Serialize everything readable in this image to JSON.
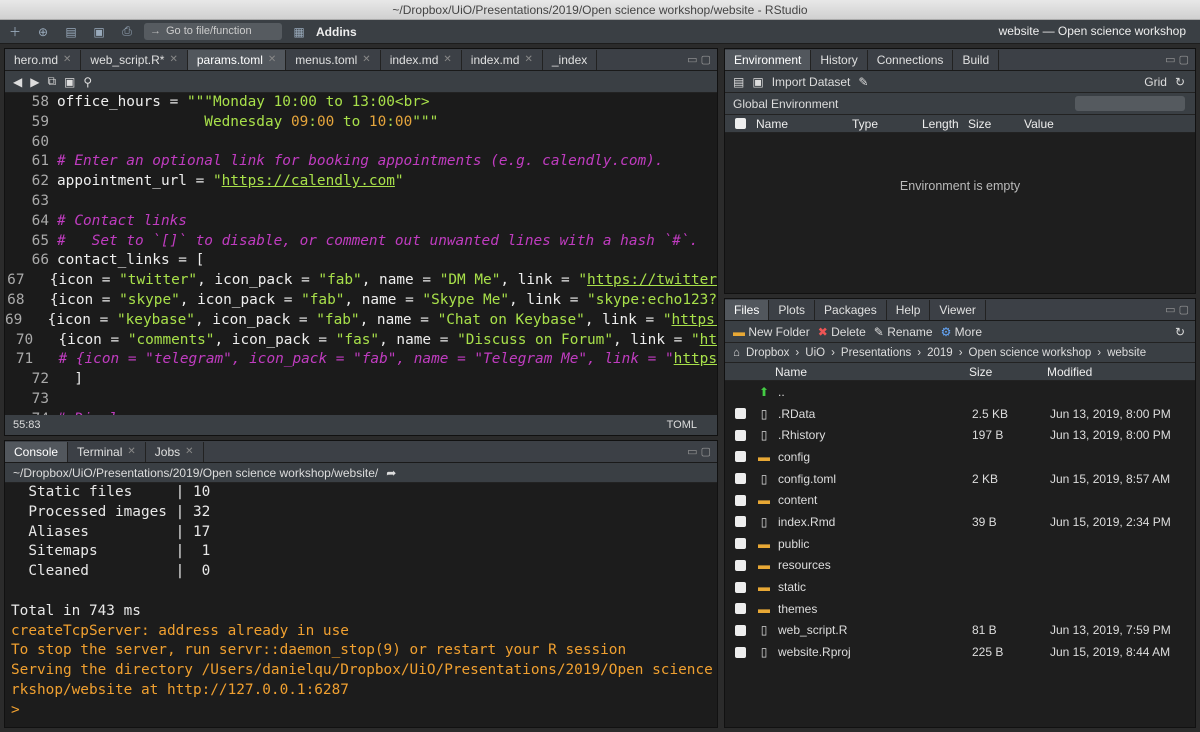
{
  "window_title": "~/Dropbox/UiO/Presentations/2019/Open science workshop/website - RStudio",
  "toolbar": {
    "goto_placeholder": "Go to file/function",
    "addins_label": "Addins",
    "project_label": "website — Open science workshop"
  },
  "editor": {
    "tabs": [
      {
        "label": "hero.md"
      },
      {
        "label": "web_script.R*"
      },
      {
        "label": "params.toml"
      },
      {
        "label": "menus.toml"
      },
      {
        "label": "index.md"
      },
      {
        "label": "index.md"
      },
      {
        "label": "_index"
      }
    ],
    "position": "55:83",
    "filetype": "TOML",
    "lines": [
      {
        "n": "58",
        "parts": [
          {
            "t": "office_hours = ",
            "c": "src"
          },
          {
            "t": "\"\"\"Monday 10:00 to 13:00<br>",
            "c": "c-str"
          }
        ]
      },
      {
        "n": "59",
        "parts": [
          {
            "t": "                 ",
            "c": "src"
          },
          {
            "t": "Wednesday ",
            "c": "c-str"
          },
          {
            "t": "09",
            "c": "c-num"
          },
          {
            "t": ":",
            "c": "c-str"
          },
          {
            "t": "00",
            "c": "c-num"
          },
          {
            "t": " to ",
            "c": "c-str"
          },
          {
            "t": "10",
            "c": "c-num"
          },
          {
            "t": ":",
            "c": "c-str"
          },
          {
            "t": "00",
            "c": "c-num"
          },
          {
            "t": "\"\"\"",
            "c": "c-str"
          }
        ]
      },
      {
        "n": "60",
        "parts": [
          {
            "t": "",
            "c": "src"
          }
        ]
      },
      {
        "n": "61",
        "parts": [
          {
            "t": "# Enter an optional link for booking appointments (e.g. calendly.com).",
            "c": "c-cm"
          }
        ]
      },
      {
        "n": "62",
        "parts": [
          {
            "t": "appointment_url = ",
            "c": "src"
          },
          {
            "t": "\"",
            "c": "c-str"
          },
          {
            "t": "https://calendly.com",
            "c": "c-url"
          },
          {
            "t": "\"",
            "c": "c-str"
          }
        ]
      },
      {
        "n": "63",
        "parts": [
          {
            "t": "",
            "c": "src"
          }
        ]
      },
      {
        "n": "64",
        "parts": [
          {
            "t": "# Contact links",
            "c": "c-cm"
          }
        ]
      },
      {
        "n": "65",
        "parts": [
          {
            "t": "#   Set to `[]` to disable, or comment out unwanted lines with a hash `#`.",
            "c": "c-cm"
          }
        ]
      },
      {
        "n": "66",
        "parts": [
          {
            "t": "contact_links = [",
            "c": "src"
          }
        ]
      },
      {
        "n": "67",
        "parts": [
          {
            "t": "  {icon = ",
            "c": "src"
          },
          {
            "t": "\"twitter\"",
            "c": "c-str"
          },
          {
            "t": ", icon_pack = ",
            "c": "src"
          },
          {
            "t": "\"fab\"",
            "c": "c-str"
          },
          {
            "t": ", name = ",
            "c": "src"
          },
          {
            "t": "\"DM Me\"",
            "c": "c-str"
          },
          {
            "t": ", link = ",
            "c": "src"
          },
          {
            "t": "\"",
            "c": "c-str"
          },
          {
            "t": "https://twitter",
            "c": "c-url"
          }
        ]
      },
      {
        "n": "68",
        "parts": [
          {
            "t": "  {icon = ",
            "c": "src"
          },
          {
            "t": "\"skype\"",
            "c": "c-str"
          },
          {
            "t": ", icon_pack = ",
            "c": "src"
          },
          {
            "t": "\"fab\"",
            "c": "c-str"
          },
          {
            "t": ", name = ",
            "c": "src"
          },
          {
            "t": "\"Skype Me\"",
            "c": "c-str"
          },
          {
            "t": ", link = ",
            "c": "src"
          },
          {
            "t": "\"skype:echo123?",
            "c": "c-str"
          }
        ]
      },
      {
        "n": "69",
        "parts": [
          {
            "t": "  {icon = ",
            "c": "src"
          },
          {
            "t": "\"keybase\"",
            "c": "c-str"
          },
          {
            "t": ", icon_pack = ",
            "c": "src"
          },
          {
            "t": "\"fab\"",
            "c": "c-str"
          },
          {
            "t": ", name = ",
            "c": "src"
          },
          {
            "t": "\"Chat on Keybase\"",
            "c": "c-str"
          },
          {
            "t": ", link = ",
            "c": "src"
          },
          {
            "t": "\"",
            "c": "c-str"
          },
          {
            "t": "https:",
            "c": "c-url"
          }
        ]
      },
      {
        "n": "70",
        "parts": [
          {
            "t": "  {icon = ",
            "c": "src"
          },
          {
            "t": "\"comments\"",
            "c": "c-str"
          },
          {
            "t": ", icon_pack = ",
            "c": "src"
          },
          {
            "t": "\"fas\"",
            "c": "c-str"
          },
          {
            "t": ", name = ",
            "c": "src"
          },
          {
            "t": "\"Discuss on Forum\"",
            "c": "c-str"
          },
          {
            "t": ", link = ",
            "c": "src"
          },
          {
            "t": "\"",
            "c": "c-str"
          },
          {
            "t": "ht",
            "c": "c-url"
          }
        ]
      },
      {
        "n": "71",
        "parts": [
          {
            "t": "  # {icon = \"telegram\", icon_pack = \"fab\", name = \"Telegram Me\", link = \"",
            "c": "c-cm"
          },
          {
            "t": "https",
            "c": "c-url"
          }
        ]
      },
      {
        "n": "72",
        "parts": [
          {
            "t": "  ]",
            "c": "src"
          }
        ]
      },
      {
        "n": "73",
        "parts": [
          {
            "t": "",
            "c": "src"
          }
        ]
      },
      {
        "n": "74",
        "parts": [
          {
            "t": "# Display a map",
            "c": "c-cm"
          }
        ]
      }
    ]
  },
  "console": {
    "tabs": [
      {
        "label": "Console"
      },
      {
        "label": "Terminal"
      },
      {
        "label": "Jobs"
      }
    ],
    "path": "~/Dropbox/UiO/Presentations/2019/Open science workshop/website/",
    "lines": [
      {
        "t": "  Static files     | 10",
        "warn": false
      },
      {
        "t": "  Processed images | 32",
        "warn": false
      },
      {
        "t": "  Aliases          | 17",
        "warn": false
      },
      {
        "t": "  Sitemaps         |  1",
        "warn": false
      },
      {
        "t": "  Cleaned          |  0",
        "warn": false
      },
      {
        "t": "",
        "warn": false
      },
      {
        "t": "Total in 743 ms",
        "warn": false
      },
      {
        "t": "createTcpServer: address already in use",
        "warn": true
      },
      {
        "t": "To stop the server, run servr::daemon_stop(9) or restart your R session",
        "warn": true
      },
      {
        "t": "Serving the directory /Users/danielqu/Dropbox/UiO/Presentations/2019/Open science wo",
        "warn": true
      },
      {
        "t": "rkshop/website at http://127.0.0.1:6287",
        "warn": true
      },
      {
        "t": ">",
        "warn": true
      }
    ]
  },
  "env": {
    "tabs": [
      {
        "label": "Environment"
      },
      {
        "label": "History"
      },
      {
        "label": "Connections"
      },
      {
        "label": "Build"
      }
    ],
    "import_label": "Import Dataset",
    "grid_label": "Grid",
    "scope_label": "Global Environment",
    "columns": [
      "Name",
      "Type",
      "Length",
      "Size",
      "Value"
    ],
    "empty_text": "Environment is empty"
  },
  "files": {
    "tabs": [
      {
        "label": "Files"
      },
      {
        "label": "Plots"
      },
      {
        "label": "Packages"
      },
      {
        "label": "Help"
      },
      {
        "label": "Viewer"
      }
    ],
    "new_folder_label": "New Folder",
    "delete_label": "Delete",
    "rename_label": "Rename",
    "more_label": "More",
    "breadcrumb": [
      "Dropbox",
      "UiO",
      "Presentations",
      "2019",
      "Open science workshop",
      "website"
    ],
    "columns": {
      "name": "Name",
      "size": "Size",
      "modified": "Modified"
    },
    "up_label": "..",
    "rows": [
      {
        "name": ".RData",
        "size": "2.5 KB",
        "modified": "Jun 13, 2019, 8:00 PM",
        "icon": "file-icon"
      },
      {
        "name": ".Rhistory",
        "size": "197 B",
        "modified": "Jun 13, 2019, 8:00 PM",
        "icon": "file-icon"
      },
      {
        "name": "config",
        "size": "",
        "modified": "",
        "icon": "folder-icon"
      },
      {
        "name": "config.toml",
        "size": "2 KB",
        "modified": "Jun 15, 2019, 8:57 AM",
        "icon": "file-icon"
      },
      {
        "name": "content",
        "size": "",
        "modified": "",
        "icon": "folder-icon"
      },
      {
        "name": "index.Rmd",
        "size": "39 B",
        "modified": "Jun 15, 2019, 2:34 PM",
        "icon": "file-icon"
      },
      {
        "name": "public",
        "size": "",
        "modified": "",
        "icon": "folder-icon"
      },
      {
        "name": "resources",
        "size": "",
        "modified": "",
        "icon": "folder-icon"
      },
      {
        "name": "static",
        "size": "",
        "modified": "",
        "icon": "folder-icon"
      },
      {
        "name": "themes",
        "size": "",
        "modified": "",
        "icon": "folder-icon"
      },
      {
        "name": "web_script.R",
        "size": "81 B",
        "modified": "Jun 13, 2019, 7:59 PM",
        "icon": "file-icon"
      },
      {
        "name": "website.Rproj",
        "size": "225 B",
        "modified": "Jun 15, 2019, 8:44 AM",
        "icon": "file-icon"
      }
    ]
  }
}
